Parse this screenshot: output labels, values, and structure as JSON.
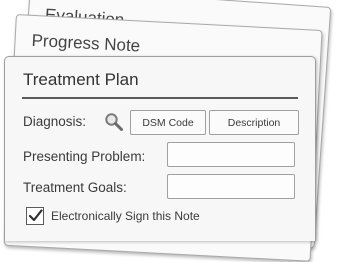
{
  "sheets": {
    "evaluation": "Evaluation",
    "progress_note": "Progress Note"
  },
  "form": {
    "title": "Treatment Plan",
    "diagnosis_label": "Diagnosis:",
    "dsm_code_button": "DSM Code",
    "description_button": "Description",
    "presenting_problem_label": "Presenting Problem:",
    "presenting_problem_value": "",
    "treatment_goals_label": "Treatment Goals:",
    "treatment_goals_value": "",
    "sign_label": "Electronically Sign this Note",
    "sign_checked": true
  },
  "icons": {
    "diagnosis_lookup": "magnifier-icon",
    "sign_check": "check-icon"
  }
}
